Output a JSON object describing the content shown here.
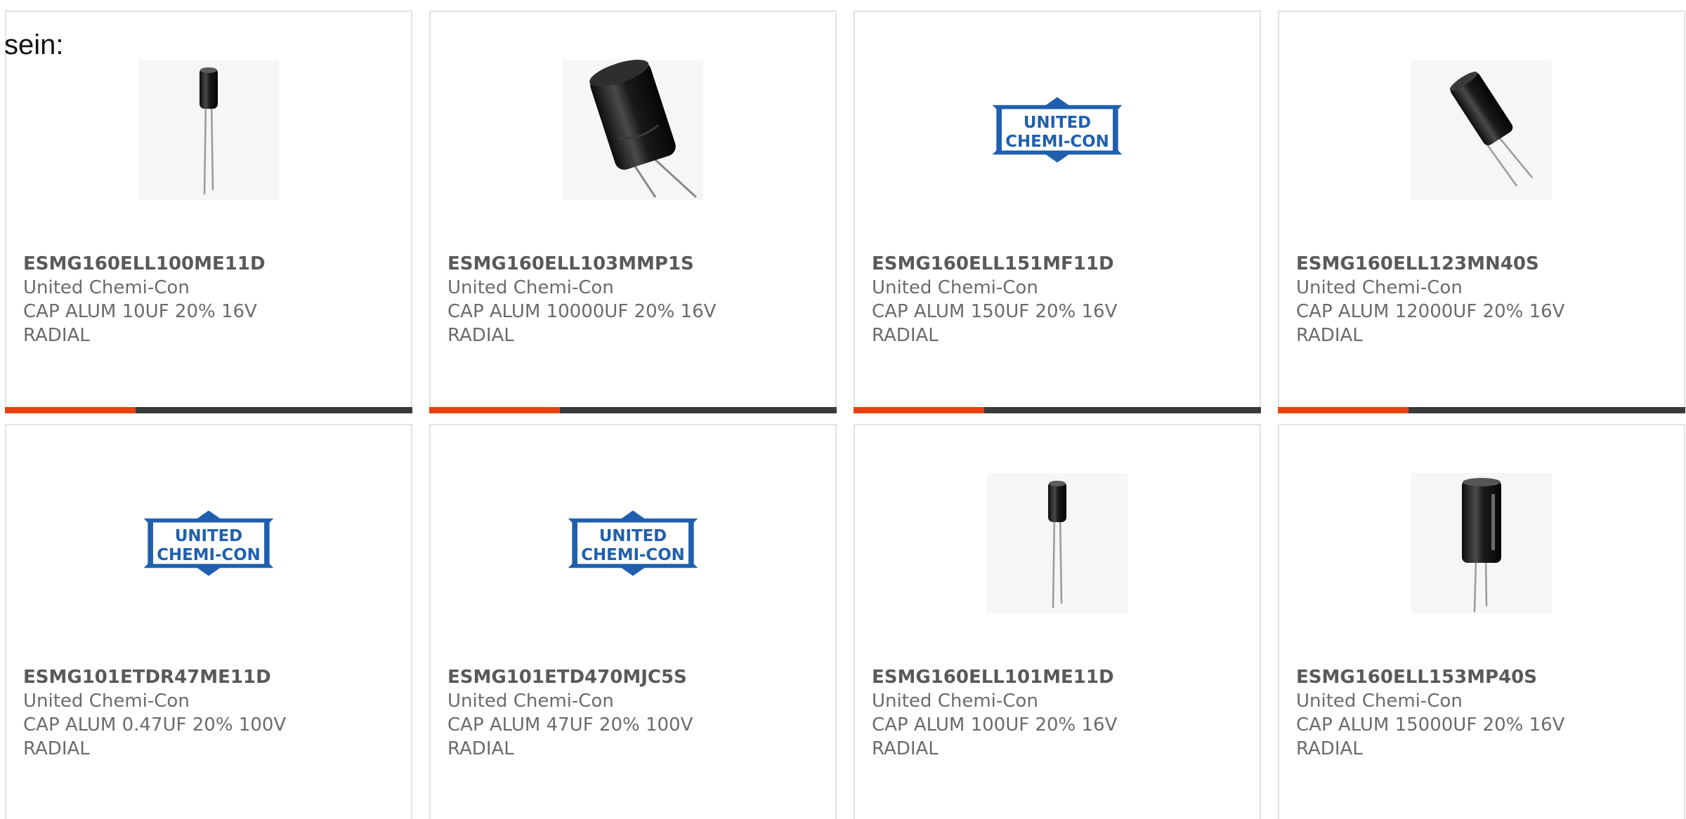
{
  "intro_text": "sein:",
  "colors": {
    "card_border": "#e2e2e2",
    "part_number": "#595959",
    "text": "#6b6b6b",
    "progress_fill": "#e8400f",
    "progress_track": "#3a3a3a",
    "logo_blue": "#1f5fae"
  },
  "products": [
    {
      "part_number": "ESMG160ELL100ME11D",
      "manufacturer": "United Chemi-Con",
      "description_line1": "CAP ALUM 10UF 20% 16V",
      "description_line2": "RADIAL",
      "image_type": "small-radial-capacitor",
      "progress": 0.32
    },
    {
      "part_number": "ESMG160ELL103MMP1S",
      "manufacturer": "United Chemi-Con",
      "description_line1": "CAP ALUM 10000UF 20% 16V",
      "description_line2": "RADIAL",
      "image_type": "large-tilted-capacitor",
      "progress": 0.32
    },
    {
      "part_number": "ESMG160ELL151MF11D",
      "manufacturer": "United Chemi-Con",
      "description_line1": "CAP ALUM 150UF 20% 16V",
      "description_line2": "RADIAL",
      "image_type": "united-chemi-con-logo",
      "logo_line1": "UNITED",
      "logo_line2": "CHEMI-CON",
      "progress": 0.32
    },
    {
      "part_number": "ESMG160ELL123MN40S",
      "manufacturer": "United Chemi-Con",
      "description_line1": "CAP ALUM 12000UF 20% 16V",
      "description_line2": "RADIAL",
      "image_type": "medium-tilted-capacitor",
      "progress": 0.32
    },
    {
      "part_number": "ESMG101ETDR47ME11D",
      "manufacturer": "United Chemi-Con",
      "description_line1": "CAP ALUM 0.47UF 20% 100V",
      "description_line2": "RADIAL",
      "image_type": "united-chemi-con-logo",
      "logo_line1": "UNITED",
      "logo_line2": "CHEMI-CON",
      "progress": null
    },
    {
      "part_number": "ESMG101ETD470MJC5S",
      "manufacturer": "United Chemi-Con",
      "description_line1": "CAP ALUM 47UF 20% 100V",
      "description_line2": "RADIAL",
      "image_type": "united-chemi-con-logo",
      "logo_line1": "UNITED",
      "logo_line2": "CHEMI-CON",
      "progress": null
    },
    {
      "part_number": "ESMG160ELL101ME11D",
      "manufacturer": "United Chemi-Con",
      "description_line1": "CAP ALUM 100UF 20% 16V",
      "description_line2": "RADIAL",
      "image_type": "small-radial-capacitor",
      "progress": null
    },
    {
      "part_number": "ESMG160ELL153MP40S",
      "manufacturer": "United Chemi-Con",
      "description_line1": "CAP ALUM 15000UF 20% 16V",
      "description_line2": "RADIAL",
      "image_type": "upright-capacitor",
      "progress": null
    }
  ]
}
